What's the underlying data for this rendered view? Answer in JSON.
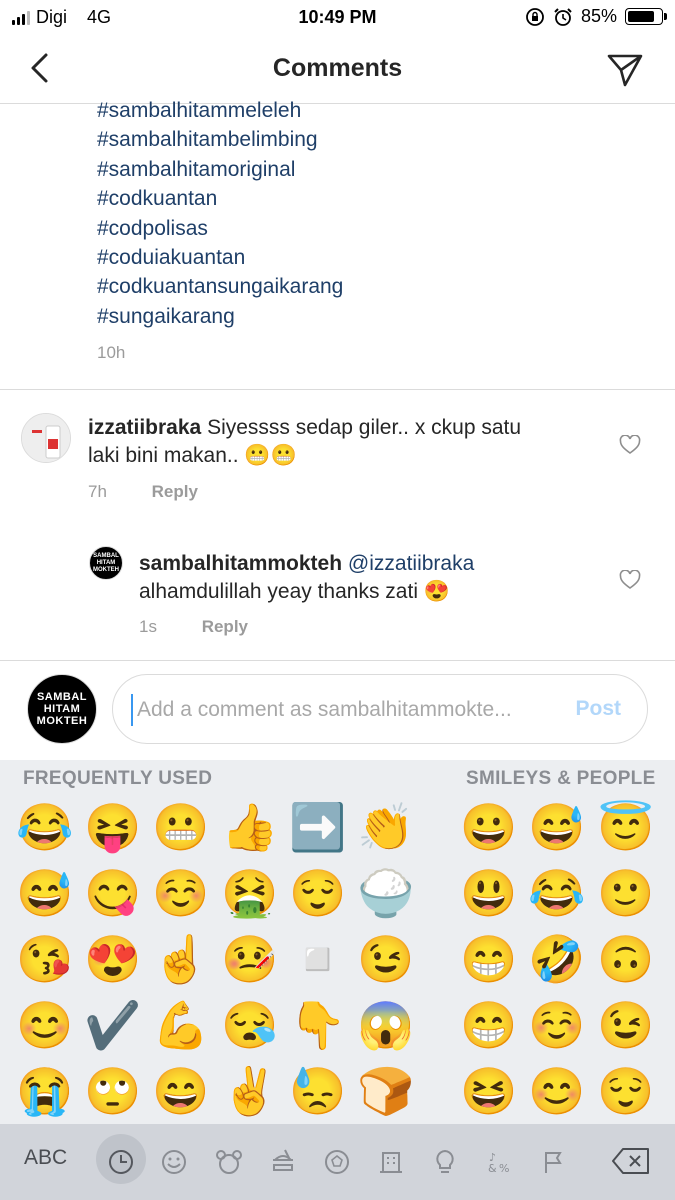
{
  "status_bar": {
    "carrier": "Digi",
    "network": "4G",
    "time": "10:49 PM",
    "battery": "85%",
    "battery_level": 0.85
  },
  "nav": {
    "title": "Comments"
  },
  "caption": {
    "hashtags": [
      "#sambalhitammeleleh",
      "#sambalhitambelimbing",
      "#sambalhitamoriginal",
      "#codkuantan",
      "#codpolisas",
      "#coduiakuantan",
      "#codkuantansungaikarang",
      "#sungaikarang"
    ],
    "time": "10h"
  },
  "comments": [
    {
      "user": "izzatiibraka",
      "text_line1": "Siyessss sedap giler.. x ckup satu",
      "text_line2": "laki bini makan.. 😬😬",
      "time": "7h",
      "reply_label": "Reply"
    },
    {
      "user": "sambalhitammokteh",
      "mention": "@izzatiibraka",
      "text": "alhamdulillah yeay thanks zati 😍",
      "time": "1s",
      "reply_label": "Reply",
      "avatar_text": [
        "SAMBAL",
        "HITAM",
        "MOKTEH"
      ]
    }
  ],
  "composer": {
    "placeholder": "Add a comment as sambalhitammokte...",
    "post_label": "Post",
    "avatar_text": [
      "SAMBAL",
      "HITAM",
      "MOKTEH"
    ]
  },
  "keyboard": {
    "section_frequent": "FREQUENTLY USED",
    "section_smileys": "SMILEYS & PEOPLE",
    "frequent_rows": [
      [
        "😂",
        "😝",
        "😬",
        "👍",
        "➡️",
        "👏"
      ],
      [
        "😅",
        "😋",
        "☺️",
        "🤮",
        "😌",
        "🍚"
      ],
      [
        "😘",
        "😍",
        "☝️",
        "🤒",
        "◽",
        "😉"
      ],
      [
        "😊",
        "✔️",
        "💪",
        "😪",
        "👇",
        "😱"
      ],
      [
        "😭",
        "🙄",
        "😄",
        "✌️",
        "😓",
        "🍞"
      ]
    ],
    "smiley_rows": [
      [
        "😀",
        "😅",
        "😇"
      ],
      [
        "😃",
        "😂",
        "🙂"
      ],
      [
        "😁",
        "🤣",
        "🙃"
      ],
      [
        "😁",
        "☺️",
        "😉"
      ],
      [
        "😆",
        "😊",
        "😌"
      ]
    ],
    "abc_label": "ABC",
    "categories": [
      "recent-clock-icon",
      "smiley-icon",
      "animal-icon",
      "food-icon",
      "ball-icon",
      "building-icon",
      "lightbulb-icon",
      "symbols-icon",
      "flag-icon"
    ]
  }
}
